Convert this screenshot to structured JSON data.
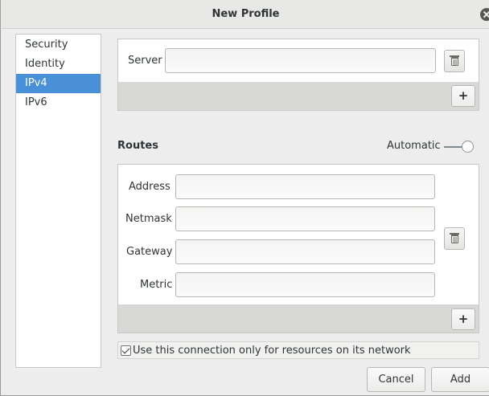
{
  "window": {
    "title": "New Profile"
  },
  "sidebar": {
    "items": [
      {
        "label": "Security"
      },
      {
        "label": "Identity"
      },
      {
        "label": "IPv4"
      },
      {
        "label": "IPv6"
      }
    ],
    "selected": "IPv4"
  },
  "dns": {
    "server_label": "Server",
    "server_value": ""
  },
  "routes": {
    "title": "Routes",
    "automatic_label": "Automatic",
    "automatic_on": false,
    "address_label": "Address",
    "netmask_label": "Netmask",
    "gateway_label": "Gateway",
    "metric_label": "Metric",
    "address_value": "",
    "netmask_value": "",
    "gateway_value": "",
    "metric_value": ""
  },
  "icons": {
    "delete": "trash-icon",
    "add": "+",
    "close": "close-icon"
  },
  "options": {
    "only_local_label": "Use this connection only for resources on its network",
    "only_local_checked": true
  },
  "footer": {
    "cancel_label": "Cancel",
    "add_label": "Add"
  },
  "colors": {
    "selection": "#4a90d9",
    "background": "#ededed"
  }
}
